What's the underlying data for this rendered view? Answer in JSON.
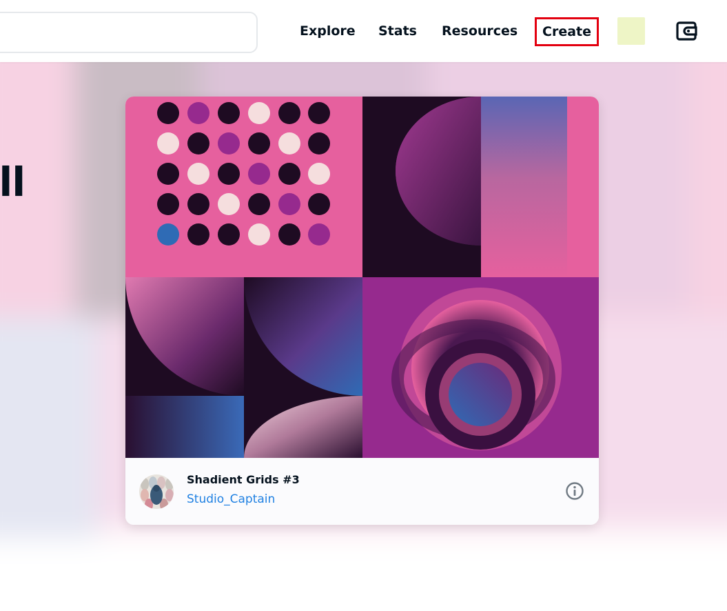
{
  "nav": {
    "explore": "Explore",
    "stats": "Stats",
    "resources": "Resources",
    "create": "Create"
  },
  "icons": {
    "wallet": "wallet-icon",
    "info": "info-icon"
  },
  "hero": {
    "title_fragment": "ell"
  },
  "featured": {
    "title": "Shadient Grids #3",
    "creator": "Studio_Captain"
  },
  "colors": {
    "link": "#2081e2",
    "highlight": "#e3000f",
    "text": "#04111d",
    "pink": "#e6609e",
    "magenta": "#962a8e",
    "dark": "#1e0b22",
    "blue": "#2f6bb5",
    "cream": "#f5dede"
  }
}
